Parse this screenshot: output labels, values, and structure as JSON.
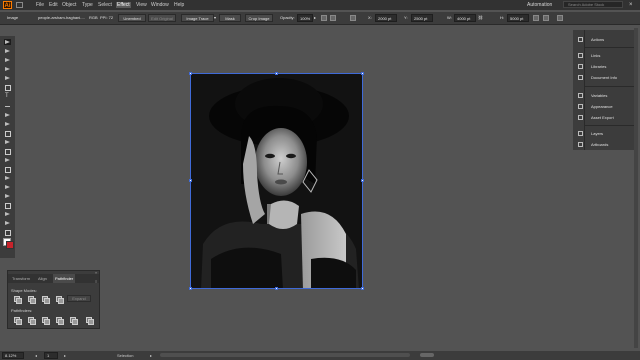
{
  "menubar": {
    "logo": "Ai",
    "items": [
      "File",
      "Edit",
      "Object",
      "Type",
      "Select",
      "Effect",
      "View",
      "Window",
      "Help"
    ],
    "active_item": "Effect",
    "workspace": "Automation",
    "search_placeholder": "Search Adobe Stock"
  },
  "controlbar": {
    "object_type": "Image",
    "filename": "people-arsham-haghani-...",
    "color_mode": "RGB",
    "ppi": "PPI: 72",
    "embed_label": "Unembed",
    "edit_original": "Edit Original",
    "image_trace": "Image Trace",
    "mask": "Mask",
    "crop_image": "Crop Image",
    "opacity_label": "Opacity:",
    "opacity_value": "100%",
    "x_label": "X:",
    "x_value": "2000 pt",
    "y_label": "Y:",
    "y_value": "2500 pt",
    "w_label": "W:",
    "w_value": "4000 pt",
    "h_label": "H:",
    "h_value": "5000 pt"
  },
  "tools": [
    "selection-tool",
    "direct-selection-tool",
    "magic-wand-tool",
    "pen-tool",
    "curvature-tool",
    "type-tool",
    "line-tool",
    "rectangle-tool",
    "paintbrush-tool",
    "shaper-tool",
    "pencil-tool",
    "eraser-tool",
    "rotate-tool",
    "scale-tool",
    "width-tool",
    "free-transform-tool",
    "shape-builder-tool",
    "perspective-tool",
    "mesh-tool",
    "gradient-tool",
    "eyedropper-tool",
    "blend-tool",
    "symbol-sprayer-tool",
    "column-graph-tool",
    "artboard-tool",
    "slice-tool",
    "hand-tool",
    "zoom-tool"
  ],
  "fill_color": "#ffffff",
  "stroke_color": "#c7232b",
  "pathfinder_panel": {
    "tabs": [
      "Transform",
      "Align",
      "Pathfinder"
    ],
    "active_tab": "Pathfinder",
    "shape_modes_label": "Shape Modes:",
    "pathfinders_label": "Pathfinders:",
    "expand_label": "Expand"
  },
  "right_panel": {
    "items": [
      "Actions",
      "Links",
      "Libraries",
      "Document Info",
      "Variables",
      "Appearance",
      "Asset Export",
      "Layers",
      "Artboards"
    ]
  },
  "statusbar": {
    "zoom": "8.12%",
    "artboard_number": "1",
    "status_text": "Selection"
  },
  "accent_color": "#3f6ad8"
}
